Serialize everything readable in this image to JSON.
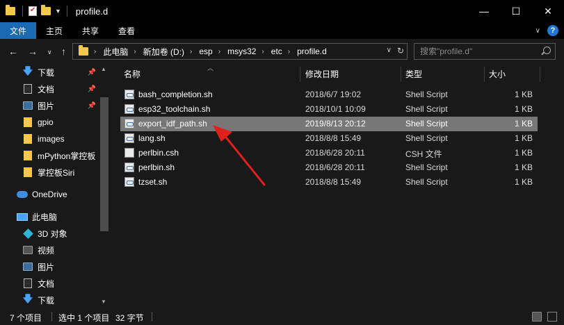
{
  "window": {
    "title": "profile.d",
    "controls": {
      "minimize": "—",
      "maximize": "☐",
      "close": "✕"
    }
  },
  "ribbon": {
    "tabs": [
      "文件",
      "主页",
      "共享",
      "查看"
    ],
    "active_tab": "文件",
    "accent_color": "#1a6bb4"
  },
  "address": {
    "breadcrumbs": [
      "此电脑",
      "新加卷 (D:)",
      "esp",
      "msys32",
      "etc",
      "profile.d"
    ]
  },
  "search": {
    "placeholder": "搜索\"profile.d\""
  },
  "sidebar": {
    "items": [
      {
        "label": "下载",
        "icon": "download-icon",
        "pinned": true
      },
      {
        "label": "文档",
        "icon": "document-icon",
        "pinned": true
      },
      {
        "label": "图片",
        "icon": "picture-icon",
        "pinned": true
      },
      {
        "label": "gpio",
        "icon": "folder-icon",
        "pinned": false
      },
      {
        "label": "images",
        "icon": "folder-icon",
        "pinned": false
      },
      {
        "label": "mPython掌控板",
        "icon": "folder-icon",
        "pinned": false
      },
      {
        "label": "掌控板Siri",
        "icon": "folder-icon",
        "pinned": false
      },
      {
        "label": "OneDrive",
        "icon": "onedrive-icon",
        "pinned": false
      },
      {
        "label": "此电脑",
        "icon": "computer-icon",
        "pinned": false
      },
      {
        "label": "3D 对象",
        "icon": "3d-objects-icon",
        "pinned": false
      },
      {
        "label": "视频",
        "icon": "video-icon",
        "pinned": false
      },
      {
        "label": "图片",
        "icon": "picture-icon",
        "pinned": false
      },
      {
        "label": "文档",
        "icon": "document-icon",
        "pinned": false
      },
      {
        "label": "下载",
        "icon": "download-icon",
        "pinned": false
      }
    ]
  },
  "columns": {
    "name": "名称",
    "date": "修改日期",
    "type": "类型",
    "size": "大小"
  },
  "files": [
    {
      "name": "bash_completion.sh",
      "date": "2018/6/7 19:02",
      "type": "Shell Script",
      "size": "1 KB",
      "selected": false
    },
    {
      "name": "esp32_toolchain.sh",
      "date": "2018/10/1 10:09",
      "type": "Shell Script",
      "size": "1 KB",
      "selected": false
    },
    {
      "name": "export_idf_path.sh",
      "date": "2019/8/13 20:12",
      "type": "Shell Script",
      "size": "1 KB",
      "selected": true
    },
    {
      "name": "lang.sh",
      "date": "2018/8/8 15:49",
      "type": "Shell Script",
      "size": "1 KB",
      "selected": false
    },
    {
      "name": "perlbin.csh",
      "date": "2018/6/28 20:11",
      "type": "CSH 文件",
      "size": "1 KB",
      "selected": false
    },
    {
      "name": "perlbin.sh",
      "date": "2018/6/28 20:11",
      "type": "Shell Script",
      "size": "1 KB",
      "selected": false
    },
    {
      "name": "tzset.sh",
      "date": "2018/8/8 15:49",
      "type": "Shell Script",
      "size": "1 KB",
      "selected": false
    }
  ],
  "status": {
    "item_count": "7 个项目",
    "selection": "选中 1 个项目",
    "selection_size": "32 字节"
  },
  "annotation": {
    "arrow_color": "#e0201c"
  }
}
